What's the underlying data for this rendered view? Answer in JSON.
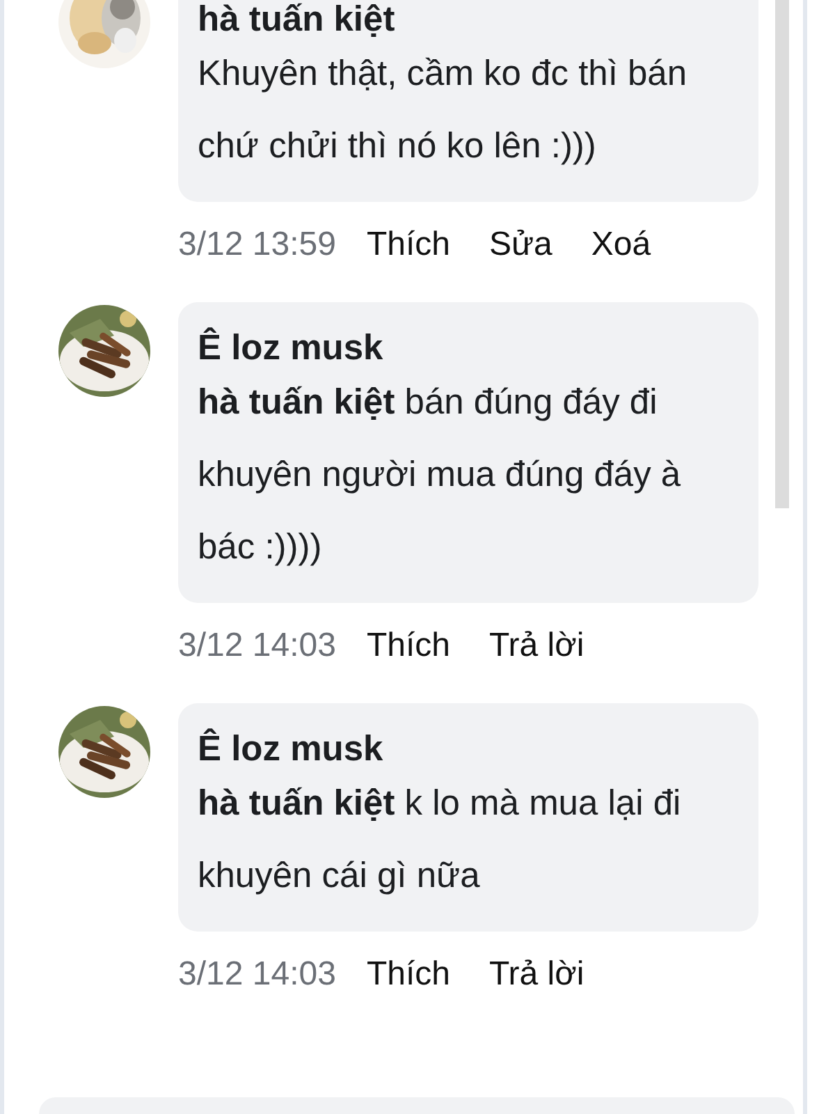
{
  "comments": [
    {
      "author": "hà tuấn kiệt",
      "text": "Khuyên thật, cầm ko đc thì bán chứ chửi thì nó ko lên :)))",
      "time": "3/12 13:59",
      "actions": [
        "Thích",
        "Sửa",
        "Xoá"
      ]
    },
    {
      "author": "Ê loz musk",
      "text": "**hà tuấn kiệt** bán đúng đáy đi khuyên người mua đúng đáy à bác :))))",
      "time": "3/12 14:03",
      "actions": [
        "Thích",
        "Trả lời"
      ]
    },
    {
      "author": "Ê loz musk",
      "text": "**hà tuấn kiệt** k lo mà mua lại đi khuyên cái gì nữa",
      "time": "3/12 14:03",
      "actions": [
        "Thích",
        "Trả lời"
      ]
    }
  ]
}
